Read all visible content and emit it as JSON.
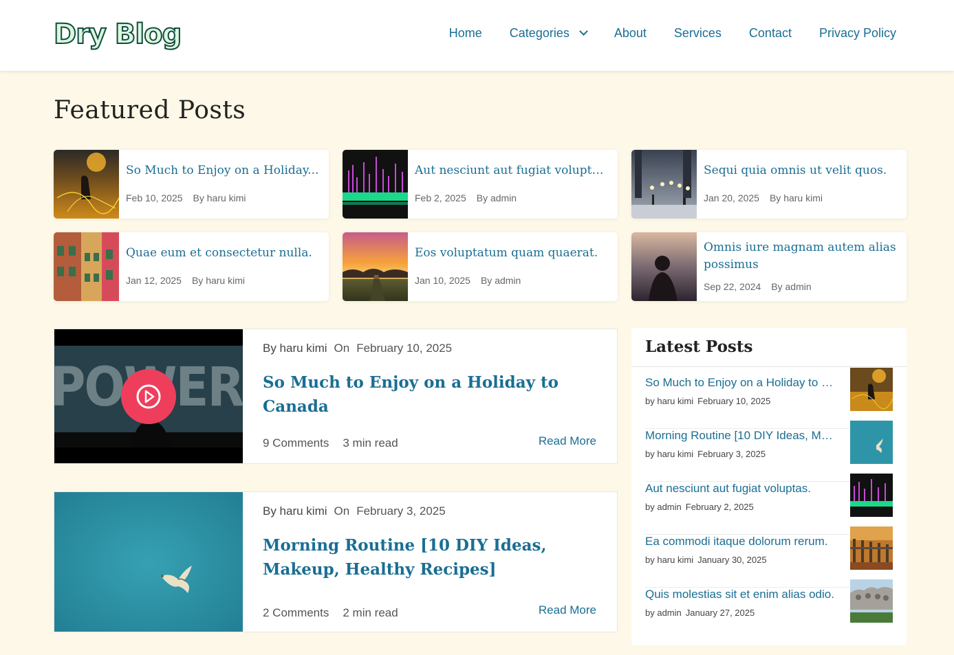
{
  "header": {
    "logo": "Dry Blog",
    "nav": [
      "Home",
      "Categories",
      "About",
      "Services",
      "Contact",
      "Privacy Policy"
    ]
  },
  "featured": {
    "title": "Featured Posts",
    "cards": [
      {
        "title": "So Much to Enjoy on a Holiday...",
        "date": "Feb 10, 2025",
        "author": "By haru kimi",
        "image": "woman-sparkler-sunset"
      },
      {
        "title": "Aut nesciunt aut fugiat voluptas.",
        "date": "Feb 2, 2025",
        "author": "By admin",
        "image": "audio-equalizer"
      },
      {
        "title": "Sequi quia omnis ut velit quos.",
        "date": "Jan 20, 2025",
        "author": "By haru kimi",
        "image": "snowy-city-street"
      },
      {
        "title": "Quae eum et consectetur nulla.",
        "date": "Jan 12, 2025",
        "author": "By haru kimi",
        "image": "colorful-building"
      },
      {
        "title": "Eos voluptatum quam quaerat.",
        "date": "Jan 10, 2025",
        "author": "By admin",
        "image": "sunset-path"
      },
      {
        "title": "Omnis iure magnam autem alias possimus",
        "date": "Sep 22, 2024",
        "author": "By admin",
        "image": "woman-city-dusk"
      }
    ]
  },
  "posts": [
    {
      "author": "By haru kimi",
      "on": "On",
      "date": "February 10, 2025",
      "title": "So Much to Enjoy on a Holiday to Canada",
      "comments": "9 Comments",
      "read_time": "3 min read",
      "read_more": "Read More",
      "image_text": "POWER",
      "play_icon": "play-circle-icon"
    },
    {
      "author": "By haru kimi",
      "on": "On",
      "date": "February 3, 2025",
      "title": "Morning Routine [10 DIY Ideas, Makeup, Healthy Recipes]",
      "comments": "2 Comments",
      "read_time": "2 min read",
      "read_more": "Read More"
    }
  ],
  "sidebar": {
    "title": "Latest Posts",
    "items": [
      {
        "title": "So Much to Enjoy on a Holiday to C...",
        "author": "by haru kimi",
        "date": "February 10, 2025"
      },
      {
        "title": "Morning Routine [10 DIY Ideas, Mak...",
        "author": "by haru kimi",
        "date": "February 3, 2025"
      },
      {
        "title": "Aut nesciunt aut fugiat voluptas.",
        "author": "by admin",
        "date": "February 2, 2025"
      },
      {
        "title": "Ea commodi itaque dolorum rerum.",
        "author": "by haru kimi",
        "date": "January 30, 2025"
      },
      {
        "title": "Quis molestias sit et enim alias odio.",
        "author": "by admin",
        "date": "January 27, 2025"
      }
    ]
  },
  "colors": {
    "page_bg": "#fdf8e7",
    "link": "#1a6e93",
    "play": "#ef3e5c",
    "logo_fill": "#dcf5dc",
    "logo_stroke": "#0f4d40"
  }
}
